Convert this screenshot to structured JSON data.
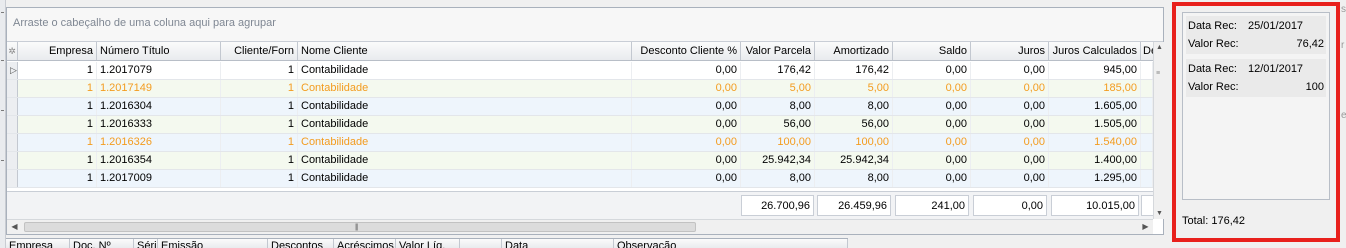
{
  "grid": {
    "group_placeholder": "Arraste o cabeçalho de uma coluna aqui para agrupar",
    "columns": [
      {
        "label": "Empresa"
      },
      {
        "label": "Número Título"
      },
      {
        "label": "Cliente/Forn"
      },
      {
        "label": "Nome Cliente"
      },
      {
        "label": "Desconto Cliente %"
      },
      {
        "label": "Valor Parcela"
      },
      {
        "label": "Amortizado"
      },
      {
        "label": "Saldo"
      },
      {
        "label": "Juros"
      },
      {
        "label": "Juros Calculados"
      },
      {
        "label": "De"
      }
    ],
    "rows": [
      {
        "empresa": "1",
        "numero": "1.2017079",
        "cliente": "1",
        "nome": "Contabilidade",
        "desconto": "0,00",
        "parcela": "176,42",
        "amortizado": "176,42",
        "saldo": "0,00",
        "juros": "0,00",
        "juros_calc": "945,00"
      },
      {
        "empresa": "1",
        "numero": "1.2017149",
        "cliente": "1",
        "nome": "Contabilidade",
        "desconto": "0,00",
        "parcela": "5,00",
        "amortizado": "5,00",
        "saldo": "0,00",
        "juros": "0,00",
        "juros_calc": "185,00"
      },
      {
        "empresa": "1",
        "numero": "1.2016304",
        "cliente": "1",
        "nome": "Contabilidade",
        "desconto": "0,00",
        "parcela": "8,00",
        "amortizado": "8,00",
        "saldo": "0,00",
        "juros": "0,00",
        "juros_calc": "1.605,00"
      },
      {
        "empresa": "1",
        "numero": "1.2016333",
        "cliente": "1",
        "nome": "Contabilidade",
        "desconto": "0,00",
        "parcela": "56,00",
        "amortizado": "56,00",
        "saldo": "0,00",
        "juros": "0,00",
        "juros_calc": "1.505,00"
      },
      {
        "empresa": "1",
        "numero": "1.2016326",
        "cliente": "1",
        "nome": "Contabilidade",
        "desconto": "0,00",
        "parcela": "100,00",
        "amortizado": "100,00",
        "saldo": "0,00",
        "juros": "0,00",
        "juros_calc": "1.540,00"
      },
      {
        "empresa": "1",
        "numero": "1.2016354",
        "cliente": "1",
        "nome": "Contabilidade",
        "desconto": "0,00",
        "parcela": "25.942,34",
        "amortizado": "25.942,34",
        "saldo": "0,00",
        "juros": "0,00",
        "juros_calc": "1.400,00"
      },
      {
        "empresa": "1",
        "numero": "1.2017009",
        "cliente": "1",
        "nome": "Contabilidade",
        "desconto": "0,00",
        "parcela": "8,00",
        "amortizado": "8,00",
        "saldo": "0,00",
        "juros": "0,00",
        "juros_calc": "1.295,00"
      }
    ],
    "totals": {
      "parcela": "26.700,96",
      "amortizado": "26.459,96",
      "saldo": "241,00",
      "juros": "0,00",
      "juros_calc": "10.015,00"
    }
  },
  "bottom_grid": {
    "columns": [
      "Empresa",
      "Doc. Nº",
      "Séri",
      "Emissão",
      "Descontos",
      "Acréscimos",
      "Valor Líq.",
      "",
      "Data",
      "Observação"
    ]
  },
  "side_panel": {
    "records": [
      {
        "date_label": "Data Rec:",
        "date": "25/01/2017",
        "value_label": "Valor Rec:",
        "value": "76,42"
      },
      {
        "date_label": "Data Rec:",
        "date": "12/01/2017",
        "value_label": "Valor Rec:",
        "value": "100"
      }
    ],
    "total_label": "Total:",
    "total_value": "176,42"
  },
  "colors": {
    "highlight_border": "#e8201c",
    "orange_row_text": "#f39c1f",
    "alt_row_a": "#f4f9ef",
    "alt_row_b": "#eef5fc"
  }
}
